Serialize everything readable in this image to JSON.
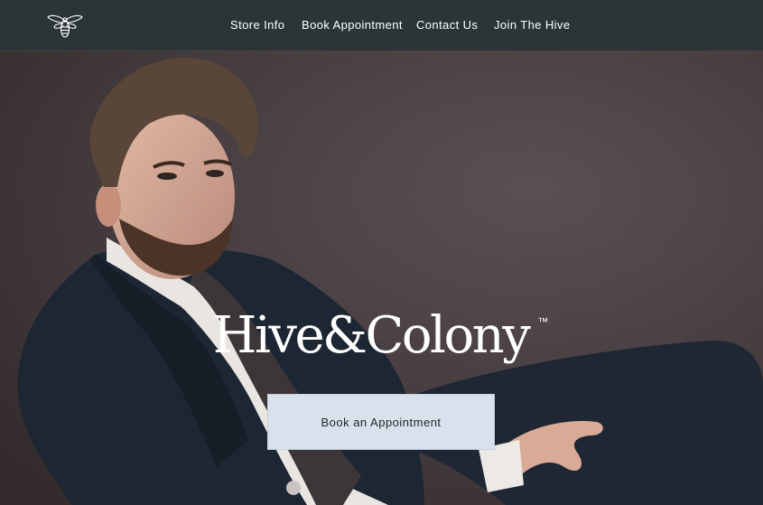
{
  "header": {
    "logo_icon": "bee-icon",
    "nav": [
      {
        "label": "Store Info"
      },
      {
        "label": "Book Appointment"
      },
      {
        "label": "Contact Us"
      },
      {
        "label": "Join The Hive"
      }
    ]
  },
  "hero": {
    "image": "man-in-suit-portrait",
    "brand": "Hive&Colony",
    "trademark": "™",
    "cta_label": "Book an Appointment"
  },
  "colors": {
    "nav_background": "#2b3537",
    "hero_background": "#4a4043",
    "cta_background": "#d9e2ec",
    "text_light": "#ffffff"
  }
}
